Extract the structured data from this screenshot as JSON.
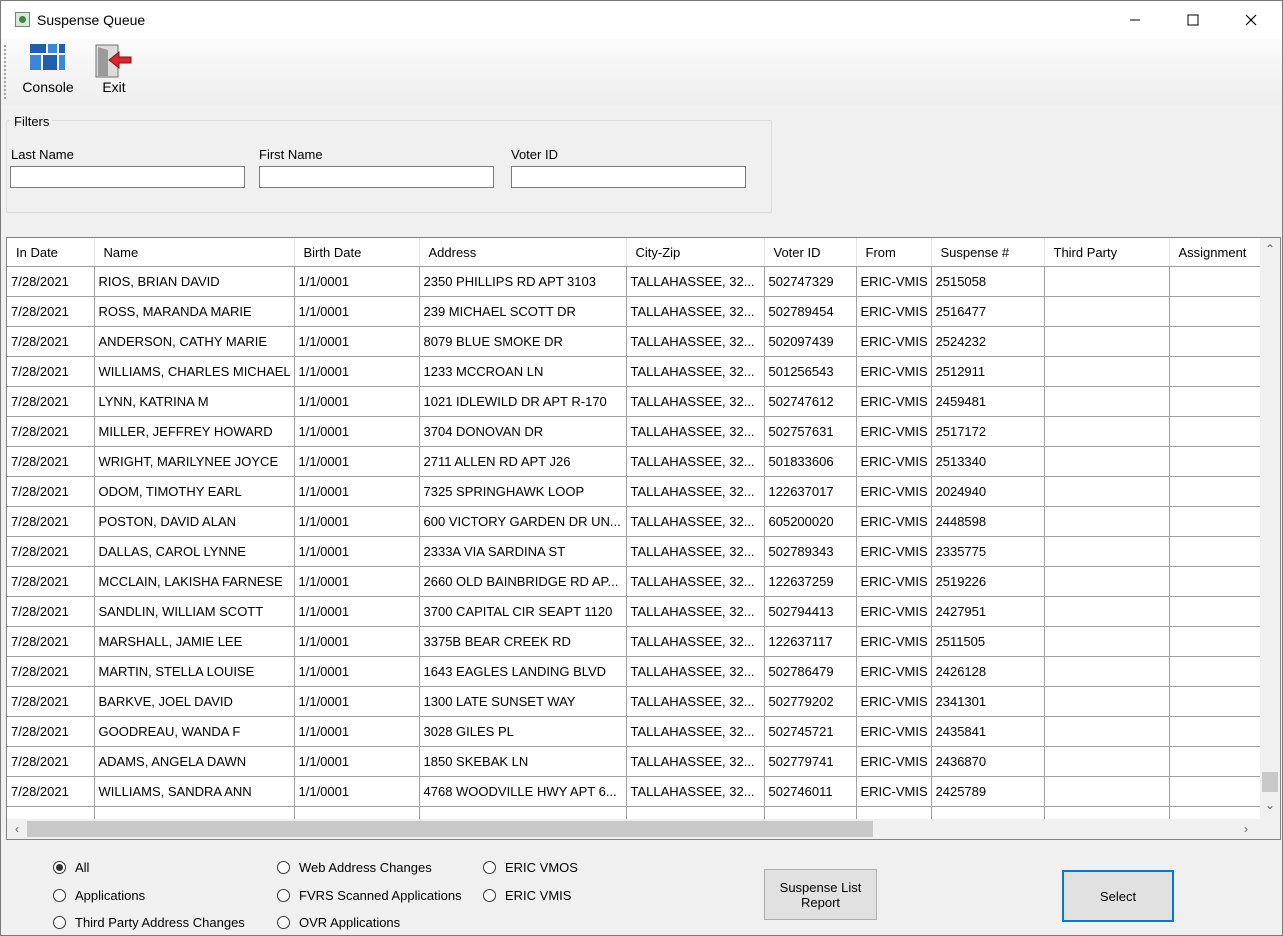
{
  "window": {
    "title": "Suspense Queue"
  },
  "toolbar": {
    "console_label": "Console",
    "exit_label": "Exit"
  },
  "filters": {
    "legend": "Filters",
    "last_name_label": "Last Name",
    "last_name_value": "",
    "first_name_label": "First Name",
    "first_name_value": "",
    "voter_id_label": "Voter ID",
    "voter_id_value": ""
  },
  "grid": {
    "columns": [
      "In Date",
      "Name",
      "Birth Date",
      "Address",
      "City-Zip",
      "Voter ID",
      "From",
      "Suspense #",
      "Third Party",
      "Assignment"
    ],
    "rows": [
      [
        "7/28/2021",
        "RIOS, BRIAN DAVID",
        "1/1/0001",
        "2350 PHILLIPS RD APT 3103",
        "TALLAHASSEE, 32...",
        "502747329",
        "ERIC-VMIS",
        "2515058",
        "",
        ""
      ],
      [
        "7/28/2021",
        "ROSS, MARANDA MARIE",
        "1/1/0001",
        "239 MICHAEL SCOTT DR",
        "TALLAHASSEE, 32...",
        "502789454",
        "ERIC-VMIS",
        "2516477",
        "",
        ""
      ],
      [
        "7/28/2021",
        "ANDERSON, CATHY MARIE",
        "1/1/0001",
        "8079 BLUE SMOKE DR",
        "TALLAHASSEE, 32...",
        "502097439",
        "ERIC-VMIS",
        "2524232",
        "",
        ""
      ],
      [
        "7/28/2021",
        "WILLIAMS, CHARLES MICHAEL",
        "1/1/0001",
        "1233 MCCROAN LN",
        "TALLAHASSEE, 32...",
        "501256543",
        "ERIC-VMIS",
        "2512911",
        "",
        ""
      ],
      [
        "7/28/2021",
        "LYNN, KATRINA M",
        "1/1/0001",
        "1021 IDLEWILD DR APT R-170",
        "TALLAHASSEE, 32...",
        "502747612",
        "ERIC-VMIS",
        "2459481",
        "",
        ""
      ],
      [
        "7/28/2021",
        "MILLER, JEFFREY HOWARD",
        "1/1/0001",
        "3704 DONOVAN DR",
        "TALLAHASSEE, 32...",
        "502757631",
        "ERIC-VMIS",
        "2517172",
        "",
        ""
      ],
      [
        "7/28/2021",
        "WRIGHT, MARILYNEE JOYCE",
        "1/1/0001",
        "2711 ALLEN RD APT J26",
        "TALLAHASSEE, 32...",
        "501833606",
        "ERIC-VMIS",
        "2513340",
        "",
        ""
      ],
      [
        "7/28/2021",
        "ODOM, TIMOTHY EARL",
        "1/1/0001",
        "7325 SPRINGHAWK LOOP",
        "TALLAHASSEE, 32...",
        "122637017",
        "ERIC-VMIS",
        "2024940",
        "",
        ""
      ],
      [
        "7/28/2021",
        "POSTON, DAVID ALAN",
        "1/1/0001",
        "600 VICTORY GARDEN DR UN...",
        "TALLAHASSEE, 32...",
        "605200020",
        "ERIC-VMIS",
        "2448598",
        "",
        ""
      ],
      [
        "7/28/2021",
        "DALLAS, CAROL LYNNE",
        "1/1/0001",
        "2333A VIA SARDINA ST",
        "TALLAHASSEE, 32...",
        "502789343",
        "ERIC-VMIS",
        "2335775",
        "",
        ""
      ],
      [
        "7/28/2021",
        "MCCLAIN, LAKISHA FARNESE",
        "1/1/0001",
        "2660 OLD BAINBRIDGE RD AP...",
        "TALLAHASSEE, 32...",
        "122637259",
        "ERIC-VMIS",
        "2519226",
        "",
        ""
      ],
      [
        "7/28/2021",
        "SANDLIN, WILLIAM SCOTT",
        "1/1/0001",
        "3700 CAPITAL CIR SEAPT 1120",
        "TALLAHASSEE, 32...",
        "502794413",
        "ERIC-VMIS",
        "2427951",
        "",
        ""
      ],
      [
        "7/28/2021",
        "MARSHALL, JAMIE LEE",
        "1/1/0001",
        "3375B BEAR CREEK RD",
        "TALLAHASSEE, 32...",
        "122637117",
        "ERIC-VMIS",
        "2511505",
        "",
        ""
      ],
      [
        "7/28/2021",
        "MARTIN, STELLA LOUISE",
        "1/1/0001",
        "1643 EAGLES LANDING BLVD",
        "TALLAHASSEE, 32...",
        "502786479",
        "ERIC-VMIS",
        "2426128",
        "",
        ""
      ],
      [
        "7/28/2021",
        "BARKVE, JOEL DAVID",
        "1/1/0001",
        "1300 LATE SUNSET WAY",
        "TALLAHASSEE, 32...",
        "502779202",
        "ERIC-VMIS",
        "2341301",
        "",
        ""
      ],
      [
        "7/28/2021",
        "GOODREAU, WANDA F",
        "1/1/0001",
        "3028 GILES PL",
        "TALLAHASSEE, 32...",
        "502745721",
        "ERIC-VMIS",
        "2435841",
        "",
        ""
      ],
      [
        "7/28/2021",
        "ADAMS, ANGELA DAWN",
        "1/1/0001",
        "1850 SKEBAK LN",
        "TALLAHASSEE, 32...",
        "502779741",
        "ERIC-VMIS",
        "2436870",
        "",
        ""
      ],
      [
        "7/28/2021",
        "WILLIAMS, SANDRA ANN",
        "1/1/0001",
        "4768 WOODVILLE HWY APT 6...",
        "TALLAHASSEE, 32...",
        "502746011",
        "ERIC-VMIS",
        "2425789",
        "",
        ""
      ]
    ]
  },
  "radios": {
    "selected": "All",
    "options": [
      "All",
      "Applications",
      "Third Party Address Changes",
      "Web Address Changes",
      "FVRS Scanned Applications",
      "OVR Applications",
      "ERIC VMOS",
      "ERIC VMIS"
    ]
  },
  "buttons": {
    "report_label": "Suspense List Report",
    "select_label": "Select"
  },
  "colors": {
    "accent": "#0078d7",
    "window_bg": "#f0f0f0",
    "console_icon": "#1f5fae",
    "exit_arrow": "#d8262c"
  },
  "icons": {
    "console": "console-icon",
    "exit": "exit-door-icon"
  }
}
